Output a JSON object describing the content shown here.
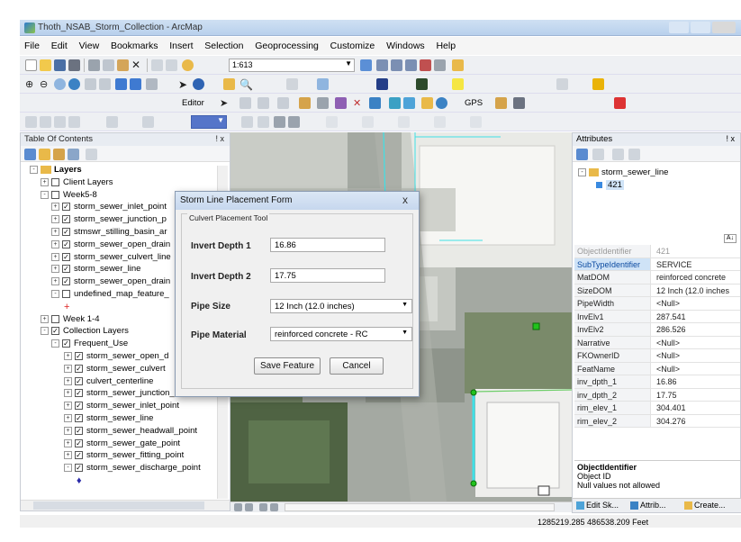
{
  "window": {
    "title": "Thoth_NSAB_Storm_Collection - ArcMap"
  },
  "menu": [
    "File",
    "Edit",
    "View",
    "Bookmarks",
    "Insert",
    "Selection",
    "Geoprocessing",
    "Customize",
    "Windows",
    "Help"
  ],
  "toolbar": {
    "scale": "1:613",
    "editor_label": "Editor",
    "gps_label": "GPS"
  },
  "toc": {
    "title": "Table Of Contents",
    "pin": "! x",
    "items": [
      {
        "text": "Layers",
        "level": 0,
        "bold": true,
        "expand": "-",
        "check": null,
        "icon": "layers"
      },
      {
        "text": "Client Layers",
        "level": 1,
        "expand": "+",
        "check": ""
      },
      {
        "text": "Week5-8",
        "level": 1,
        "expand": "-",
        "check": ""
      },
      {
        "text": "storm_sewer_inlet_point",
        "level": 2,
        "expand": "+",
        "check": "✓"
      },
      {
        "text": "storm_sewer_junction_p",
        "level": 2,
        "expand": "+",
        "check": "✓"
      },
      {
        "text": "stmswr_stilling_basin_ar",
        "level": 2,
        "expand": "+",
        "check": "✓"
      },
      {
        "text": "storm_sewer_open_drain",
        "level": 2,
        "expand": "+",
        "check": "✓"
      },
      {
        "text": "storm_sewer_culvert_line",
        "level": 2,
        "expand": "+",
        "check": "✓"
      },
      {
        "text": "storm_sewer_line",
        "level": 2,
        "expand": "+",
        "check": "✓"
      },
      {
        "text": "storm_sewer_open_drain",
        "level": 2,
        "expand": "+",
        "check": "✓"
      },
      {
        "text": "undefined_map_feature_",
        "level": 2,
        "expand": "-",
        "check": ""
      },
      {
        "text": "+",
        "level": 3,
        "expand": null,
        "check": null,
        "marker": true
      },
      {
        "text": "Week 1-4",
        "level": 1,
        "expand": "+",
        "check": ""
      },
      {
        "text": "Collection Layers",
        "level": 1,
        "expand": "-",
        "check": "✓"
      },
      {
        "text": "Frequent_Use",
        "level": 2,
        "expand": "-",
        "check": "✓"
      },
      {
        "text": "storm_sewer_open_d",
        "level": 3,
        "expand": "+",
        "check": "✓"
      },
      {
        "text": "storm_sewer_culvert",
        "level": 3,
        "expand": "+",
        "check": "✓"
      },
      {
        "text": "culvert_centerline",
        "level": 3,
        "expand": "+",
        "check": "✓"
      },
      {
        "text": "storm_sewer_junction_point",
        "level": 3,
        "expand": "+",
        "check": "✓"
      },
      {
        "text": "storm_sewer_inlet_point",
        "level": 3,
        "expand": "+",
        "check": "✓"
      },
      {
        "text": "storm_sewer_line",
        "level": 3,
        "expand": "+",
        "check": "✓"
      },
      {
        "text": "storm_sewer_headwall_point",
        "level": 3,
        "expand": "+",
        "check": "✓"
      },
      {
        "text": "storm_sewer_gate_point",
        "level": 3,
        "expand": "+",
        "check": "✓"
      },
      {
        "text": "storm_sewer_fitting_point",
        "level": 3,
        "expand": "+",
        "check": "✓"
      },
      {
        "text": "storm_sewer_discharge_point",
        "level": 3,
        "expand": "-",
        "check": "✓"
      },
      {
        "text": "♦",
        "level": 4,
        "expand": null,
        "check": null,
        "marker": true
      }
    ]
  },
  "dialog": {
    "title": "Storm Line Placement Form",
    "close": "x",
    "group_title": "Culvert Placement Tool",
    "invert_depth_1_label": "Invert Depth 1",
    "invert_depth_1_value": "16.86",
    "invert_depth_2_label": "Invert Depth 2",
    "invert_depth_2_value": "17.75",
    "pipe_size_label": "Pipe Size",
    "pipe_size_value": "12 Inch (12.0 inches)",
    "pipe_material_label": "Pipe Material",
    "pipe_material_value": "reinforced concrete - RC",
    "save_button": "Save Feature",
    "cancel_button": "Cancel"
  },
  "attributes": {
    "title": "Attributes",
    "pin": "! x",
    "tree_root": "storm_sewer_line",
    "tree_child": "421",
    "grid": [
      {
        "k": "ObjectIdentifier",
        "v": "421",
        "state": "dim"
      },
      {
        "k": "SubTypeIdentifier",
        "v": "SERVICE",
        "state": "sel"
      },
      {
        "k": "MatDOM",
        "v": "reinforced concrete",
        "state": ""
      },
      {
        "k": "SizeDOM",
        "v": "12 Inch (12.0 inches",
        "state": ""
      },
      {
        "k": "PipeWidth",
        "v": "<Null>",
        "state": ""
      },
      {
        "k": "InvElv1",
        "v": "287.541",
        "state": ""
      },
      {
        "k": "InvElv2",
        "v": "286.526",
        "state": ""
      },
      {
        "k": "Narrative",
        "v": "<Null>",
        "state": ""
      },
      {
        "k": "FKOwnerID",
        "v": "<Null>",
        "state": ""
      },
      {
        "k": "FeatName",
        "v": "<Null>",
        "state": ""
      },
      {
        "k": "inv_dpth_1",
        "v": "16.86",
        "state": ""
      },
      {
        "k": "inv_dpth_2",
        "v": "17.75",
        "state": ""
      },
      {
        "k": "rim_elev_1",
        "v": "304.401",
        "state": ""
      },
      {
        "k": "rim_elev_2",
        "v": "304.276",
        "state": ""
      }
    ],
    "desc_title": "ObjectIdentifier",
    "desc_line1": "Object ID",
    "desc_line2": "Null values not allowed",
    "tabs": [
      "Edit Sk...",
      "Attrib...",
      "Create..."
    ]
  },
  "status": {
    "coords": "1285219.285  486538.209 Feet"
  },
  "colors": {
    "selection_cyan": "#3fe0e6",
    "vertex_green": "#22c21d",
    "route_green": "#6fce6a"
  }
}
